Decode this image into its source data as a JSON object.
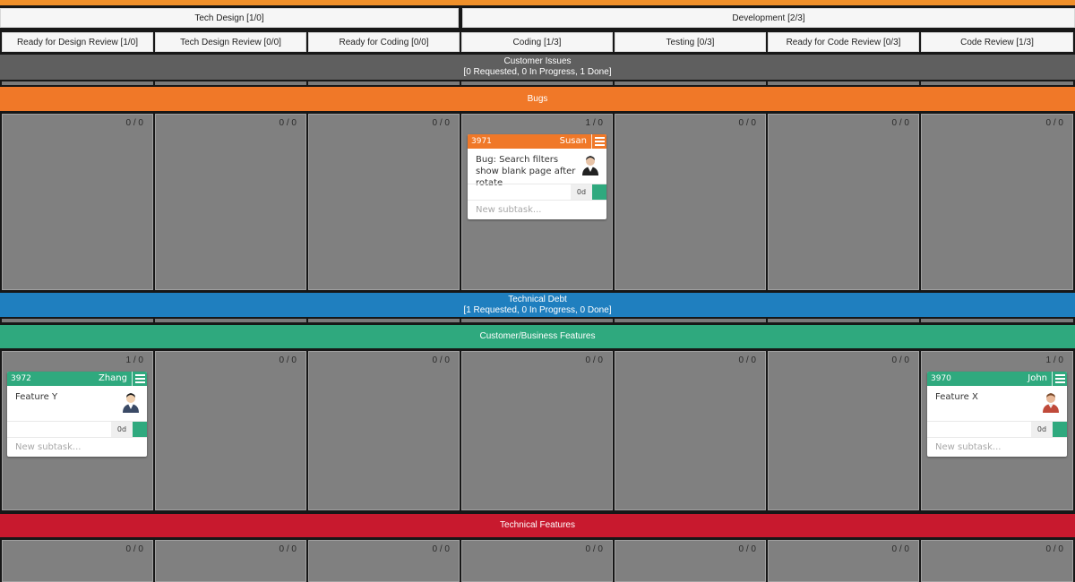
{
  "groups": [
    {
      "label": "Tech Design [1/0]"
    },
    {
      "label": "Development [2/3]"
    }
  ],
  "columns": [
    {
      "label": "Ready for Design Review [1/0]"
    },
    {
      "label": "Tech Design Review [0/0]"
    },
    {
      "label": "Ready for Coding [0/0]"
    },
    {
      "label": "Coding [1/3]"
    },
    {
      "label": "Testing [0/3]"
    },
    {
      "label": "Ready for Code Review [0/3]"
    },
    {
      "label": "Code Review [1/3]"
    }
  ],
  "colors": {
    "accent": "#f0902a",
    "customer_issues": "#5f5f5f",
    "bugs": "#f07828",
    "technical_debt": "#1f7fbf",
    "customer_business": "#2fa97e",
    "technical_features": "#c8192e"
  },
  "lanes": {
    "customer_issues": {
      "title": "Customer Issues",
      "summary": "[0 Requested, 0 In Progress, 1 Done]"
    },
    "bugs": {
      "title": "Bugs",
      "counts": [
        "0 / 0",
        "0 / 0",
        "0 / 0",
        "1 / 0",
        "0 / 0",
        "0 / 0",
        "0 / 0"
      ]
    },
    "technical_debt": {
      "title": "Technical Debt",
      "summary": "[1 Requested, 0 In Progress, 0 Done]"
    },
    "customer_business": {
      "title": "Customer/Business Features",
      "counts": [
        "1 / 0",
        "0 / 0",
        "0 / 0",
        "0 / 0",
        "0 / 0",
        "0 / 0",
        "1 / 0"
      ]
    },
    "technical_features": {
      "title": "Technical Features",
      "counts": [
        "0 / 0",
        "0 / 0",
        "0 / 0",
        "0 / 0",
        "0 / 0",
        "0 / 0",
        "0 / 0"
      ]
    }
  },
  "cards": {
    "c3971": {
      "id": "3971",
      "owner": "Susan",
      "title": "Bug: Search filters show blank page after rotate",
      "estimate": "0d",
      "subtask_placeholder": "New subtask..."
    },
    "c3972": {
      "id": "3972",
      "owner": "Zhang",
      "title": "Feature Y",
      "estimate": "0d",
      "subtask_placeholder": "New subtask..."
    },
    "c3970": {
      "id": "3970",
      "owner": "John",
      "title": "Feature X",
      "estimate": "0d",
      "subtask_placeholder": "New subtask..."
    }
  }
}
